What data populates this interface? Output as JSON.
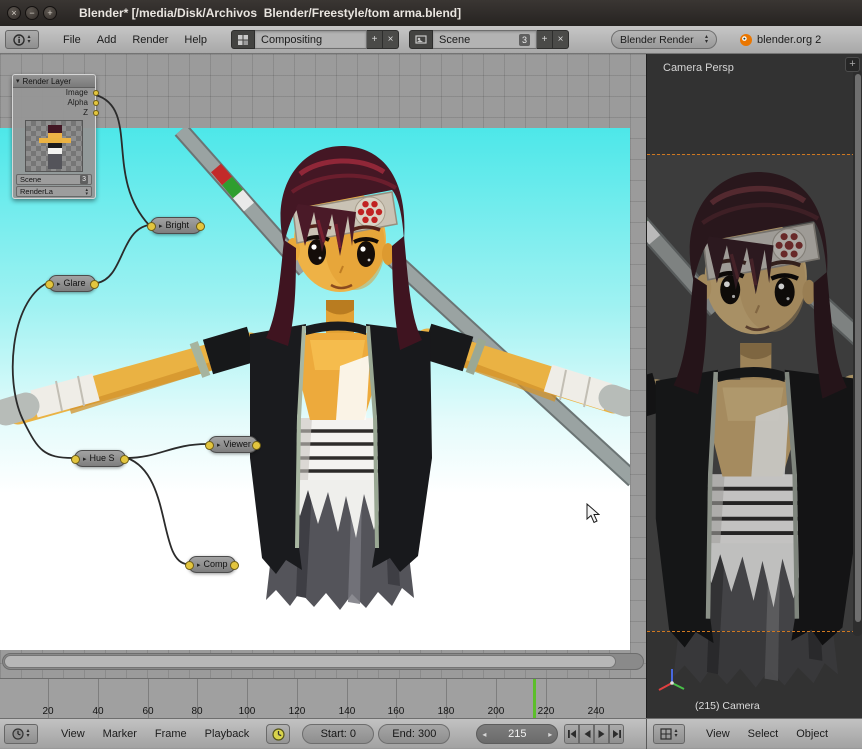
{
  "titlebar": {
    "title": "Blender* [/media/Disk/Archivos  Blender/Freestyle/tom arma.blend]",
    "close": "×",
    "minimize": "−",
    "maximize": "+"
  },
  "info_header": {
    "menus": [
      "File",
      "Add",
      "Render",
      "Help"
    ],
    "layout_selector": {
      "value": "Compositing",
      "add_label": "+",
      "close_label": "×"
    },
    "scene_selector": {
      "value": "Scene",
      "user_count": "3",
      "add_label": "+",
      "close_label": "×"
    },
    "engine_selector": {
      "value": "Blender Render"
    },
    "web_link": {
      "label": "blender.org 2"
    }
  },
  "node_editor": {
    "render_layer_node": {
      "title": "Render Layer",
      "outputs": [
        "Image",
        "Alpha",
        "Z"
      ],
      "scene_field": "Scene",
      "scene_count": "3",
      "layer_field": "RenderLa"
    },
    "nodes": {
      "bright": "Bright",
      "glare": "Glare",
      "hue": "Hue S",
      "viewer": "Viewer",
      "composite": "Comp"
    }
  },
  "viewport3d": {
    "view_label": "Camera Persp",
    "camera_label": "(215) Camera"
  },
  "timeline": {
    "ticks": [
      "20",
      "40",
      "60",
      "80",
      "100",
      "120",
      "140",
      "160",
      "180",
      "200",
      "220",
      "240"
    ],
    "current_frame": "215"
  },
  "timeline_header": {
    "menus": [
      "View",
      "Marker",
      "Frame",
      "Playback"
    ],
    "start_field": "Start: 0",
    "end_field": "End: 300",
    "frame_field": "215"
  },
  "viewport_header": {
    "menus": [
      "View",
      "Select",
      "Object"
    ]
  },
  "colors": {
    "camera_border_orange": "#d07820",
    "current_frame_green": "#5cbf2a",
    "socket_yellow": "#e3c53e",
    "blender_logo_orange": "#ea7600"
  }
}
